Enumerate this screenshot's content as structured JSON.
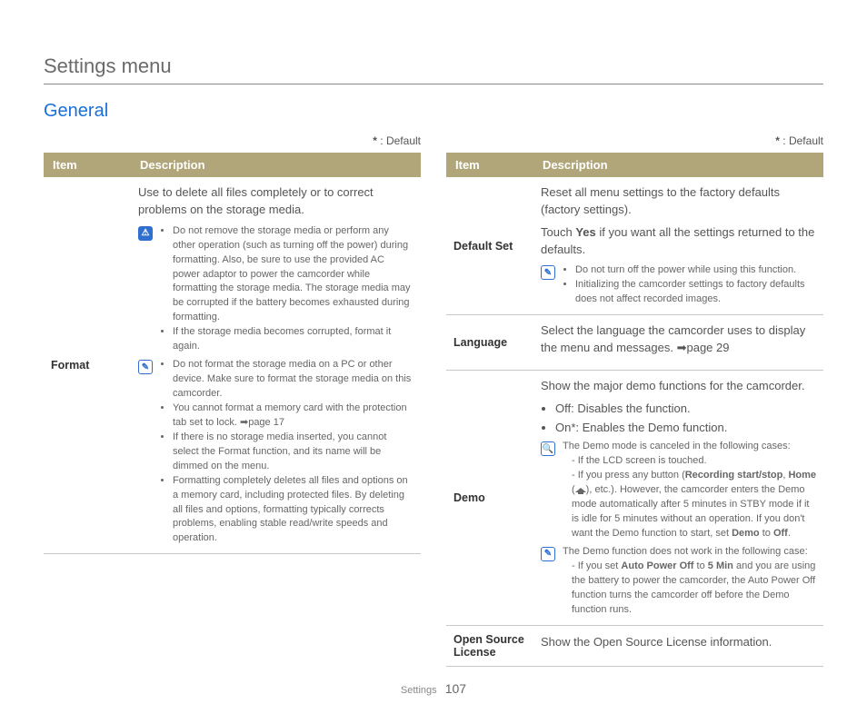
{
  "page_title": "Settings menu",
  "section_title": "General",
  "default_marker": "*",
  "default_label": " : Default",
  "headers": {
    "item": "Item",
    "desc": "Description"
  },
  "left": {
    "format": {
      "item": "Format",
      "lead": "Use to delete all files completely or to correct problems on the storage media.",
      "warn": [
        "Do not remove the storage media or perform any other operation (such as turning off the power) during formatting. Also, be sure to use the provided AC power adaptor to power the camcorder while formatting the storage media. The storage media may be corrupted if the battery becomes exhausted during formatting.",
        "If the storage media becomes corrupted, format it again."
      ],
      "tip": [
        "Do not format the storage media on a PC or other device. Make sure to format the storage media on this camcorder.",
        "You cannot format a memory card with the protection tab set to lock. ➡page 17",
        "If there is no storage media inserted, you cannot select the Format function, and its name will be dimmed on the menu.",
        "Formatting completely deletes all files and options on a memory card, including protected files. By deleting all files and options, formatting typically corrects problems, enabling stable read/write speeds and operation."
      ]
    }
  },
  "right": {
    "default_set": {
      "item": "Default Set",
      "lead1": "Reset all menu settings to the factory defaults (factory settings).",
      "lead2a": "Touch ",
      "lead2b": "Yes",
      "lead2c": " if you want all the settings returned to the defaults.",
      "tip": [
        "Do not turn off the power while using this function.",
        "Initializing the camcorder settings to factory defaults does not affect recorded images."
      ]
    },
    "language": {
      "item": "Language",
      "lead": "Select the language the camcorder uses to display the menu and messages. ➡page 29"
    },
    "demo": {
      "item": "Demo",
      "lead": "Show the major demo functions for the camcorder.",
      "opts_off_a": "Off",
      "opts_off_b": ": Disables the function.",
      "opts_on_a": "On*",
      "opts_on_b": ": Enables the Demo function.",
      "mag_lead": "The Demo mode is canceled in the following cases:",
      "mag_l1": "- If the LCD screen is touched.",
      "mag_l2a": "- If you press any button (",
      "mag_l2b": "Recording start/stop",
      "mag_l2c": ", ",
      "mag_l2d": "Home",
      "mag_l2e": " (",
      "mag_l2f": "), etc.). However, the camcorder enters the Demo mode automatically after 5 minutes in STBY mode if it is idle for 5 minutes without an operation. If you don't want the Demo function to start, set ",
      "mag_l2g": "Demo",
      "mag_l2h": " to ",
      "mag_l2i": "Off",
      "mag_l2j": ".",
      "tip_lead": "The Demo function does not work in the following case:",
      "tip_l1a": "- If you set ",
      "tip_l1b": "Auto Power Off",
      "tip_l1c": " to ",
      "tip_l1d": "5 Min",
      "tip_l1e": " and you are using the battery to power the camcorder, the Auto Power Off function turns the camcorder off before the Demo function runs."
    },
    "osl": {
      "item": "Open Source License",
      "lead": "Show the Open Source License information."
    }
  },
  "footer": {
    "section": "Settings",
    "page": "107"
  }
}
